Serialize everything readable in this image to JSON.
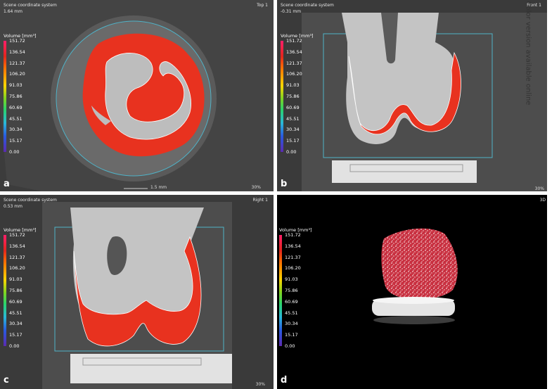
{
  "side_note": "Color version available online",
  "legend": {
    "title": "Volume [mm³]",
    "ticks": [
      "151.72",
      "136.54",
      "121.37",
      "106.20",
      "91.03",
      "75.86",
      "60.69",
      "45.51",
      "30.34",
      "15.17",
      "0.00"
    ]
  },
  "panels": [
    {
      "id": "a",
      "label": "a",
      "system": "Scene coordinate system",
      "value": "1.64 mm",
      "view": "Top 1",
      "zoom": "30%",
      "scale": "1.5 mm"
    },
    {
      "id": "b",
      "label": "b",
      "system": "Scene coordinate system",
      "value": "-0.31 mm",
      "view": "Front 1",
      "zoom": "30%"
    },
    {
      "id": "c",
      "label": "c",
      "system": "Scene coordinate system",
      "value": "0.53 mm",
      "view": "Right 1",
      "zoom": "30%"
    },
    {
      "id": "d",
      "label": "d",
      "view": "3D"
    }
  ],
  "colors": {
    "segment": "#e8321f",
    "bone": "#c8c8c8",
    "frame": "#4fb2c7"
  }
}
